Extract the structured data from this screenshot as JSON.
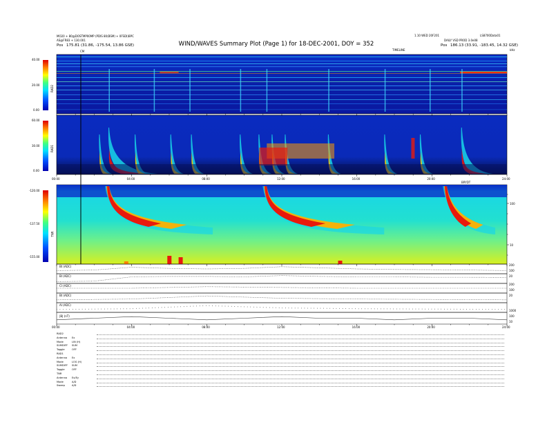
{
  "header": {
    "title": "WIND/WAVES Summary Plot (Page 1) for 18-DEC-2001, DOY = 352",
    "left_line1": "MO20 + 80@DOSTMP00MP (PDIS 80(BSM) + 0FSDI)BPC",
    "left_line2": "AS@FR83 + 130.001",
    "left_pos_label": "Pos",
    "left_pos_value": "175.81 (31.86, -175.54, 13.86 GSE)",
    "right_line1": "1.10 WED 20F201",
    "right_line2": "LS8700Data01",
    "right_line3": "DAILY VSD PROD 3.0e08",
    "right_pos_label": "Pos",
    "right_pos_value": "186.13 (33.91, -183.45, 14.32 GSE)",
    "timeline_label": "TIMELINE",
    "right_unit": "kHz",
    "marker_label": "CM"
  },
  "panels": {
    "rad2_label": "RAD2",
    "rad2_ticks": [
      "40.00",
      "20.00",
      "0.00"
    ],
    "rad1_label": "RAD1",
    "rad1_ticks": [
      "60.00",
      "30.00",
      "0.00"
    ],
    "tnr_label": "TNR",
    "tnr_ticks": [
      "-120.00",
      "-137.50",
      "-155.00"
    ],
    "tnr_right_ticks": [
      "100",
      "10"
    ],
    "mid_time_label": "BRYDT",
    "time_ticks": [
      "00:00",
      "04:00",
      "08:00",
      "12:00",
      "16:00",
      "20:00",
      "24:00"
    ],
    "line_labels": [
      "Bt (ADC)",
      "Bl (ADC)",
      "Cl (ADC)",
      "Bt (ADC)",
      "Al (ADC)",
      "|B| (nT)"
    ],
    "line_right_ticks": [
      "200",
      "100",
      "20",
      "200",
      "100",
      "20",
      "1000",
      "100",
      "10"
    ]
  },
  "status": {
    "rows": [
      {
        "k": "RAD2",
        "v": ""
      },
      {
        "k": "Antenna",
        "v": "Ex"
      },
      {
        "k": "Mode",
        "v": "LIN (H)"
      },
      {
        "k": "SUMDIFF",
        "v": "SUM"
      },
      {
        "k": "Toggle",
        "v": "OFF"
      },
      {
        "k": "RAD1",
        "v": ""
      },
      {
        "k": "Antenna",
        "v": "Ex"
      },
      {
        "k": "Mode",
        "v": "LOG (H)"
      },
      {
        "k": "SUMDIFF",
        "v": "SUM"
      },
      {
        "k": "Toggle",
        "v": "OFF"
      },
      {
        "k": "TNR",
        "v": ""
      },
      {
        "k": "Antenna",
        "v": "Ex/Ey"
      },
      {
        "k": "Mode",
        "v": "A/D"
      },
      {
        "k": "Sweep",
        "v": "A/D"
      }
    ]
  },
  "colors": {
    "spectrum_low": "#0a1fa8",
    "spectrum_mid": "#19d6e6",
    "spectrum_high": "#e81a0d",
    "tnr_base": "#2fe6b8"
  },
  "chart_data": [
    {
      "type": "heatmap",
      "title": "WIND/WAVES Summary Plot (Page 1) for 18-DEC-2001, DOY = 352",
      "name": "RAD2",
      "xlabel": "",
      "ylabel": "RAD2",
      "xlim": [
        "00:00",
        "24:00"
      ],
      "ylim": [
        0,
        40
      ],
      "colorbar_ticks": [
        0,
        20,
        40
      ],
      "bursts_hours": [
        2.8,
        5.2,
        7.1,
        9.8,
        11.2,
        14.5,
        17.5,
        19.9,
        21.6
      ]
    },
    {
      "type": "heatmap",
      "name": "RAD1",
      "xlabel": "",
      "ylabel": "RAD1",
      "xlim": [
        "00:00",
        "24:00"
      ],
      "ylim": [
        0,
        60
      ],
      "colorbar_ticks": [
        0,
        30,
        60
      ],
      "bursts_hours": [
        2.3,
        2.8,
        4.2,
        6.1,
        7.2,
        9.8,
        10.8,
        11.5,
        12.2,
        14.5,
        17.5,
        19.4,
        21.6
      ]
    },
    {
      "type": "heatmap",
      "name": "TNR",
      "xlabel": "",
      "ylabel": "TNR",
      "xlim": [
        "00:00",
        "24:00"
      ],
      "ylim": [
        -155,
        -120
      ],
      "colorbar_ticks": [
        -155,
        -137.5,
        -120
      ],
      "right_axis_ticks": [
        10,
        100
      ],
      "bursts_hours": [
        2.8,
        11.2,
        20.8
      ]
    },
    {
      "type": "line",
      "name": "Bt (ADC)",
      "x": [
        0,
        2,
        4,
        6,
        8,
        10,
        12,
        14,
        16,
        18,
        20,
        22,
        24
      ],
      "y": [
        120,
        125,
        150,
        140,
        135,
        140,
        155,
        145,
        135,
        130,
        128,
        125,
        120
      ]
    },
    {
      "type": "line",
      "name": "Bl (ADC)",
      "x": [
        0,
        2,
        4,
        6,
        8,
        10,
        12,
        14,
        16,
        18,
        20,
        22,
        24
      ],
      "y": [
        40,
        45,
        95,
        100,
        100,
        95,
        110,
        100,
        95,
        95,
        90,
        90,
        88
      ]
    },
    {
      "type": "line",
      "name": "Cl (ADC)",
      "x": [
        0,
        4,
        8,
        12,
        16,
        20,
        24
      ],
      "y": [
        60,
        60,
        62,
        61,
        60,
        60,
        60
      ]
    },
    {
      "type": "line",
      "name": "Al (ADC)",
      "x": [
        0,
        4,
        8,
        12,
        16,
        20,
        24
      ],
      "y": [
        80,
        82,
        90,
        84,
        82,
        81,
        80
      ]
    },
    {
      "type": "line",
      "name": "|B| (nT)",
      "x": [
        0,
        2,
        4,
        6,
        8,
        10,
        12,
        14,
        16,
        18,
        20,
        22,
        24
      ],
      "y": [
        5,
        6,
        7,
        6,
        5,
        6,
        7,
        6,
        6,
        5,
        6,
        6,
        5
      ]
    }
  ]
}
